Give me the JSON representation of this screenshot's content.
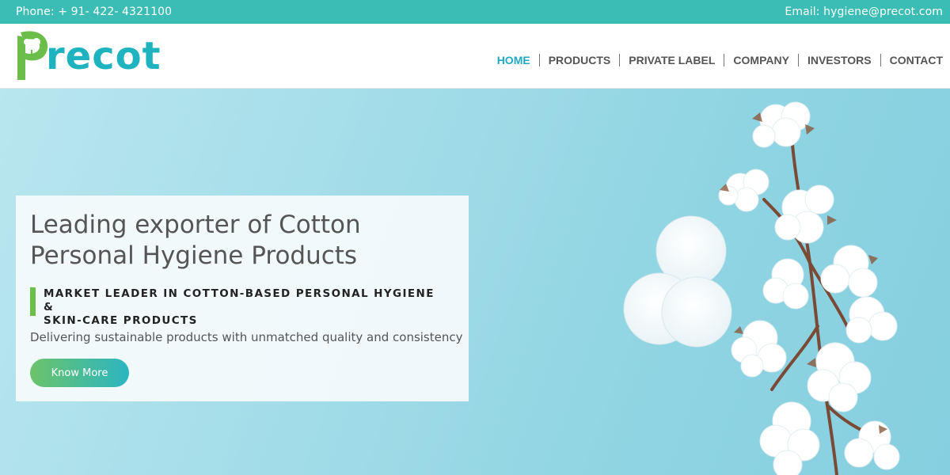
{
  "topbar": {
    "phone": "Phone: + 91- 422- 4321100",
    "email": "Email: hygiene@precot.com"
  },
  "brand": {
    "logo_text": "recot",
    "logo_letter": "P",
    "colors": {
      "teal": "#1fb3c0",
      "green": "#6bbe4a",
      "topbar": "#3bbdb6"
    }
  },
  "nav": {
    "items": [
      {
        "label": "HOME",
        "active": true
      },
      {
        "label": "PRODUCTS",
        "active": false
      },
      {
        "label": "PRIVATE LABEL",
        "active": false
      },
      {
        "label": "COMPANY",
        "active": false
      },
      {
        "label": "INVESTORS",
        "active": false
      },
      {
        "label": "CONTACT",
        "active": false
      }
    ]
  },
  "hero": {
    "title_line1": "Leading exporter of Cotton",
    "title_line2": "Personal Hygiene Products",
    "subtitle_line1": "MARKET LEADER IN COTTON-BASED PERSONAL HYGIENE &",
    "subtitle_line2": "SKIN-CARE PRODUCTS",
    "description": "Delivering sustainable products with unmatched quality and consistency",
    "button_label": "Know More",
    "background_colors": [
      "#b9e6ef",
      "#86cfe0"
    ]
  },
  "icons": {
    "logo": "cotton-logo-icon",
    "hero_image": "cotton-flowers-and-pads-image"
  }
}
